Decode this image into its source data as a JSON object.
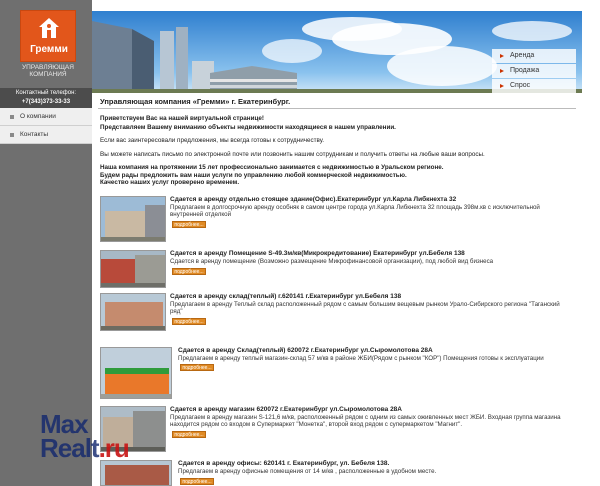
{
  "sidebar": {
    "logo_name": "Гремми",
    "logo_subtitle_line1": "УПРАВЛЯЮЩАЯ",
    "logo_subtitle_line2": "КОМПАНИЯ",
    "contact_label": "Контактный телефон:",
    "contact_phone": "+7(343)373-33-33",
    "nav": [
      {
        "label": "О компании"
      },
      {
        "label": "Контакты"
      }
    ]
  },
  "banner_menu": [
    {
      "label": "Аренда"
    },
    {
      "label": "Продажа"
    },
    {
      "label": "Спрос"
    }
  ],
  "main": {
    "title": "Управляющая компания «Гремми» г. Екатеринбург.",
    "intro": [
      "Приветствуем Вас на нашей виртуальной странице!",
      "Представляем Вашему вниманию объекты недвижимости находящиеся в нашем управлении.",
      "Если вас заинтересовали предложения, мы всегда готовы к сотрудничеству.",
      "Вы можете написать письмо по электронной почте или позвонить нашим сотрудникам и получить ответы на любые ваши вопросы.",
      "Наша компания на протяжении 15 лет профессионально занимается с недвижимостью в Уральском регионе.",
      "Будем рады предложить вам наши услуги по управлению любой коммерческой недвижимостью.",
      "Качество наших услуг проверено временем."
    ],
    "more_label": "подробнее...",
    "listings": [
      {
        "title": "Сдается в аренду отдельно стоящее здание(Офис).Екатеринбург ул.Карла Либкнехта 32",
        "desc": "Предлагаем в долгосрочную аренду особняк в самом центре города ул.Карла Либкнехта 32 площадь 398м.кв с исключительной внутренней отделкой"
      },
      {
        "title": "Сдается в аренду Помещение S-49.3м/кв(Микрокредитование) Екатеринбург ул.Бебеля 138",
        "desc": "Сдается в аренду помещение (Возможно размещение Микрофинансовой организации), под любой вид бизнеса"
      },
      {
        "title": "Сдается в аренду склад(теплый) г.620141 г.Екатеринбург ул.Бебеля 138",
        "desc": "Предлагаем в аренду Теплый склад расположенный рядом с самым большим вещевым рынком Урало-Сибирского региона \"Таганский ряд\""
      },
      {
        "title": "Сдается в аренду Склад(теплый) 620072 г.Екатеринбург ул.Сыромолотова 28А",
        "desc": "Предлагаем в аренду теплый магазин-склад 57 м/кв в районе ЖБИ(Рядом с рынком \"КОР\") Помещения готовы к эксплуатации"
      },
      {
        "title": "Сдается в аренду магазин 620072 г.Екатеринбург ул.Сыромолотова 28А",
        "desc": "Предлагаем в аренду магазин S-121,6 м/кв, расположенный рядом с одним из самых оживленных мест ЖБИ. Входная группа магазина находится рядом со входом в Супермаркет \"Монетка\", второй вход рядом с супермаркетом \"Магнит\"."
      },
      {
        "title": "Сдается в аренду офисы: 620141 г. Екатеринбург, ул. Бебеля 138.",
        "desc": "Предлагаем в аренду офисные помещения от 14 м/кв , расположенные в удобном месте."
      }
    ]
  },
  "watermark": {
    "line1_a": "Max",
    "line2_a": "Realt",
    "line2_b": ".ru"
  },
  "colors": {
    "sidebar": "#6f6f6f",
    "logo": "#e2561b",
    "accent": "#e08a24",
    "sky": "#2f7fcf"
  }
}
